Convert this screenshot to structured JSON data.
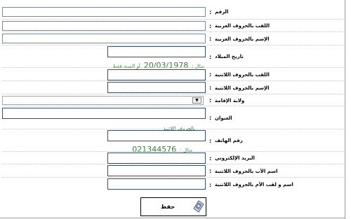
{
  "form": {
    "fields": [
      {
        "id": "number",
        "label": "الرقم"
      },
      {
        "id": "surname_ar",
        "label": "اللقب بالحروف العربية"
      },
      {
        "id": "name_ar",
        "label": "الإسم بالحروف العربية"
      },
      {
        "id": "birthdate",
        "label": "تاريخ الميلاد",
        "hint_example": "مثال :",
        "hint_value": "20/03/1978",
        "hint_suffix": "أو السنة فقط"
      },
      {
        "id": "surname_lat",
        "label": "اللقب بالحروف اللاتنية"
      },
      {
        "id": "name_lat",
        "label": "الإسم بالحروف اللاتنية"
      },
      {
        "id": "wilaya",
        "label": "ولاية الإقامة",
        "select_arrow": "▼"
      },
      {
        "id": "address",
        "label": "العنوان",
        "hint": "بالحروف اللاتنية"
      },
      {
        "id": "phone",
        "label": "رقم الهاتف",
        "hint_example": "مثال :",
        "hint_value": "021344576"
      },
      {
        "id": "email",
        "label": "البريد الإلكتروني"
      },
      {
        "id": "father_name",
        "label": "اسم الأب بالحروف اللاتنية"
      },
      {
        "id": "mother_name",
        "label": "اسم و لقب الأم بالحروف اللاتنية"
      }
    ],
    "colon": ":",
    "save_label": "حفظ",
    "save_icon": "save-diskette-icon"
  }
}
